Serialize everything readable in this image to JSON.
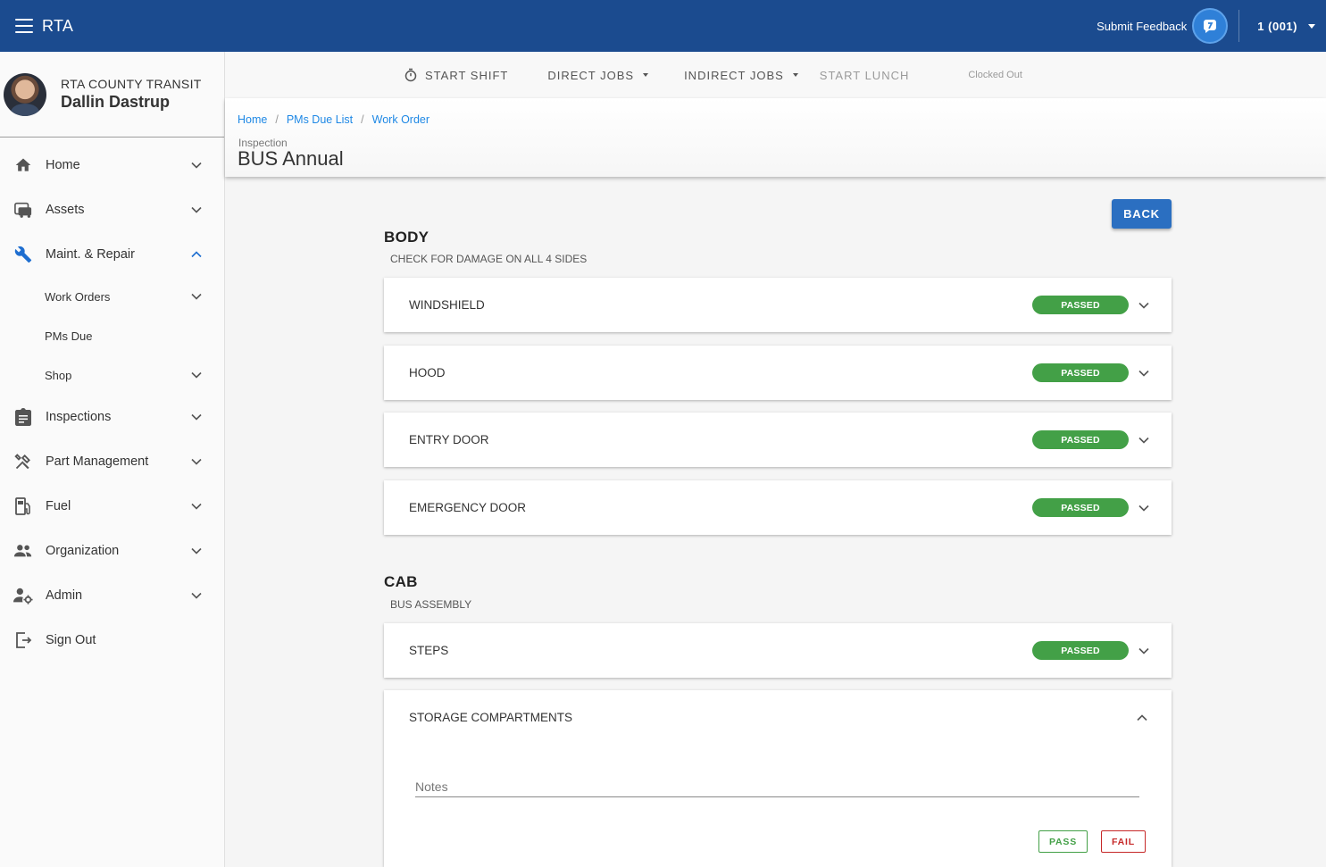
{
  "appbar": {
    "title": "RTA",
    "feedback_label": "Submit Feedback",
    "account": "1 (001)"
  },
  "sidebar": {
    "org": "RTA COUNTY TRANSIT",
    "user": "Dallin Dastrup",
    "items": [
      {
        "label": "Home",
        "icon": "home-icon"
      },
      {
        "label": "Assets",
        "icon": "bus-icon"
      },
      {
        "label": "Maint. & Repair",
        "icon": "wrench-icon",
        "expanded": true
      },
      {
        "label": "Work Orders"
      },
      {
        "label": "PMs Due"
      },
      {
        "label": "Shop"
      },
      {
        "label": "Inspections",
        "icon": "clipboard-icon"
      },
      {
        "label": "Part Management",
        "icon": "tools-icon"
      },
      {
        "label": "Fuel",
        "icon": "fuel-icon"
      },
      {
        "label": "Organization",
        "icon": "people-icon"
      },
      {
        "label": "Admin",
        "icon": "admin-icon"
      },
      {
        "label": "Sign Out",
        "icon": "sign-out-icon"
      }
    ]
  },
  "toolbar": {
    "start_shift": "START SHIFT",
    "direct_jobs": "DIRECT JOBS",
    "indirect_jobs": "INDIRECT JOBS",
    "start_lunch": "START LUNCH",
    "status": "Clocked Out"
  },
  "breadcrumb": [
    "Home",
    "PMs Due List",
    "Work Order"
  ],
  "header": {
    "subtitle": "Inspection",
    "title": "BUS Annual"
  },
  "back_label": "BACK",
  "sections": [
    {
      "title": "BODY",
      "subtitle": "CHECK FOR DAMAGE ON ALL 4 SIDES",
      "items": [
        {
          "name": "WINDSHIELD",
          "status": "PASSED"
        },
        {
          "name": "HOOD",
          "status": "PASSED"
        },
        {
          "name": "ENTRY DOOR",
          "status": "PASSED"
        },
        {
          "name": "EMERGENCY DOOR",
          "status": "PASSED"
        }
      ]
    },
    {
      "title": "CAB",
      "subtitle": "BUS ASSEMBLY",
      "items": [
        {
          "name": "STEPS",
          "status": "PASSED"
        },
        {
          "name": "STORAGE COMPARTMENTS",
          "notes_placeholder": "Notes",
          "pass_label": "PASS",
          "fail_label": "FAIL"
        }
      ]
    }
  ],
  "colors": {
    "appbar": "#1b4b8f",
    "passed": "#43a047",
    "fail": "#c62828",
    "link": "#1e88e5",
    "back_button": "#2b6fc1",
    "active_nav": "#1e6ed0"
  }
}
